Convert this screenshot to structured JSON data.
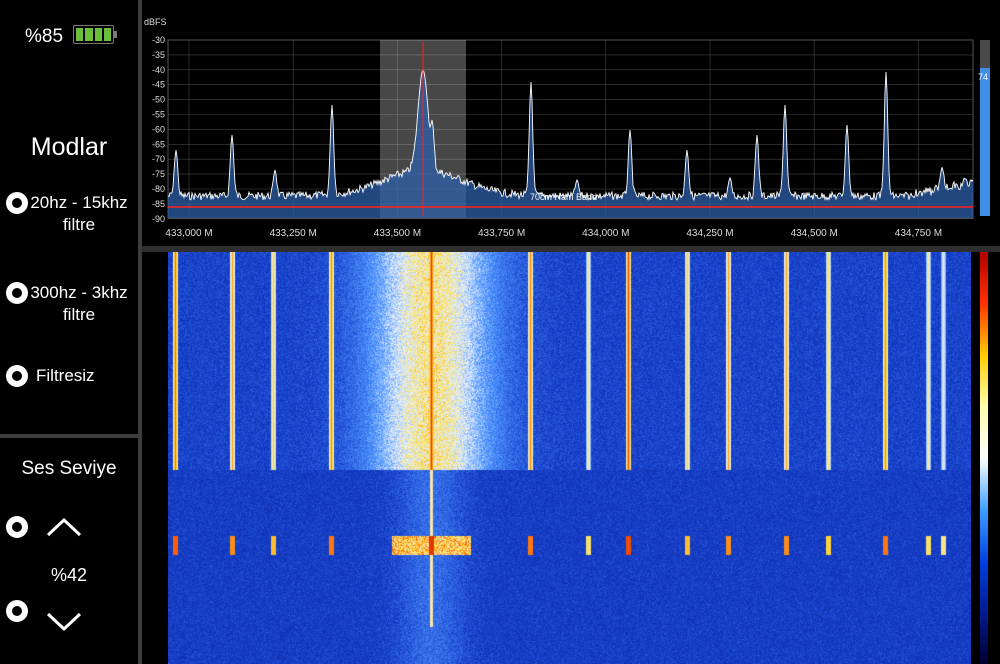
{
  "battery": {
    "percent_label": "%85",
    "level": 0.85,
    "color": "#6abf3a"
  },
  "modes": {
    "title": "Modlar",
    "items": [
      {
        "line1": "20hz - 15khz",
        "line2": "filtre"
      },
      {
        "line1": "300hz - 3khz",
        "line2": "filtre"
      },
      {
        "line1": "Filtresiz",
        "line2": ""
      }
    ]
  },
  "volume": {
    "title": "Ses Seviye",
    "value_label": "%42",
    "level": 0.42
  },
  "spectrum": {
    "unit_label": "dBFS",
    "y_ticks": [
      "-30",
      "-35",
      "-40",
      "-45",
      "-50",
      "-55",
      "-60",
      "-65",
      "-70",
      "-75",
      "-80",
      "-85",
      "-90"
    ],
    "x_ticks": [
      "433,000 M",
      "433,250 M",
      "433,500 M",
      "433,750 M",
      "434,000 M",
      "434,250 M",
      "434,500 M",
      "434,750 M"
    ],
    "band_label": "70cm Ham Band",
    "level_readout": "74",
    "colors": {
      "trace": "#ffffff",
      "fill": "#2c5fa8",
      "marker": "#ff2020",
      "selection": "#ffffff",
      "grid": "#444444"
    }
  }
}
